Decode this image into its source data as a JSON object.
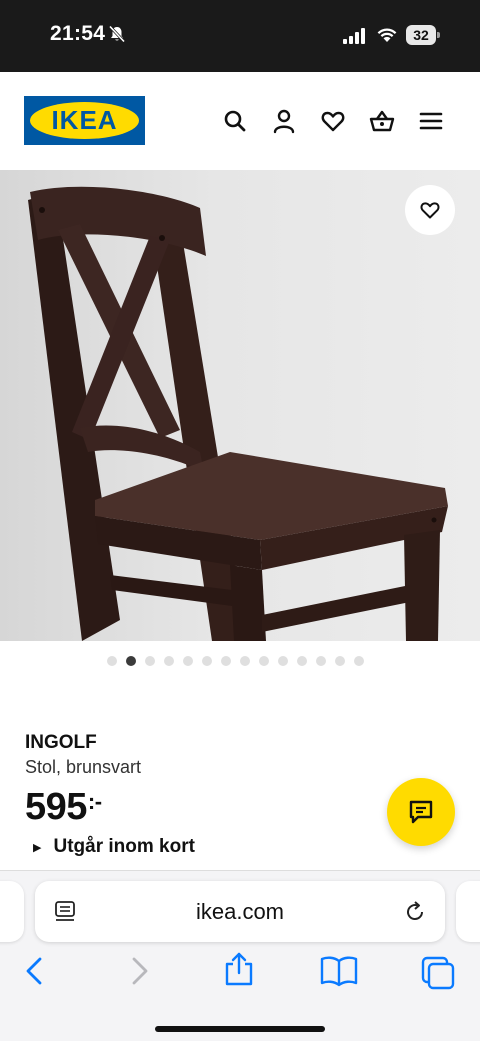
{
  "status_bar": {
    "time": "21:54",
    "battery_level": "32",
    "icons": [
      "bell-off-icon",
      "cellular-signal-icon",
      "wifi-icon",
      "battery-icon"
    ]
  },
  "header": {
    "logo_text": "IKEA",
    "brand_colors": {
      "blue": "#0058a3",
      "yellow": "#ffdb00"
    },
    "icons": [
      "search-icon",
      "account-icon",
      "wishlist-heart-icon",
      "shopping-basket-icon",
      "menu-icon"
    ]
  },
  "product": {
    "image_alt_icon": "chair-illustration",
    "favorite_icon": "heart-icon",
    "carousel": {
      "total": 14,
      "active_index": 1
    },
    "name": "INGOLF",
    "description": "Stol, brunsvart",
    "price": "595",
    "price_suffix": ":-",
    "availability": "Utgår inom kort",
    "chat_icon": "chat-bubble-icon"
  },
  "browser": {
    "url": "ikea.com",
    "toolbar_icons": [
      "back-arrow-icon",
      "forward-arrow-icon",
      "share-icon",
      "bookmarks-icon",
      "tabs-icon"
    ],
    "accent": "#0a7aff"
  }
}
